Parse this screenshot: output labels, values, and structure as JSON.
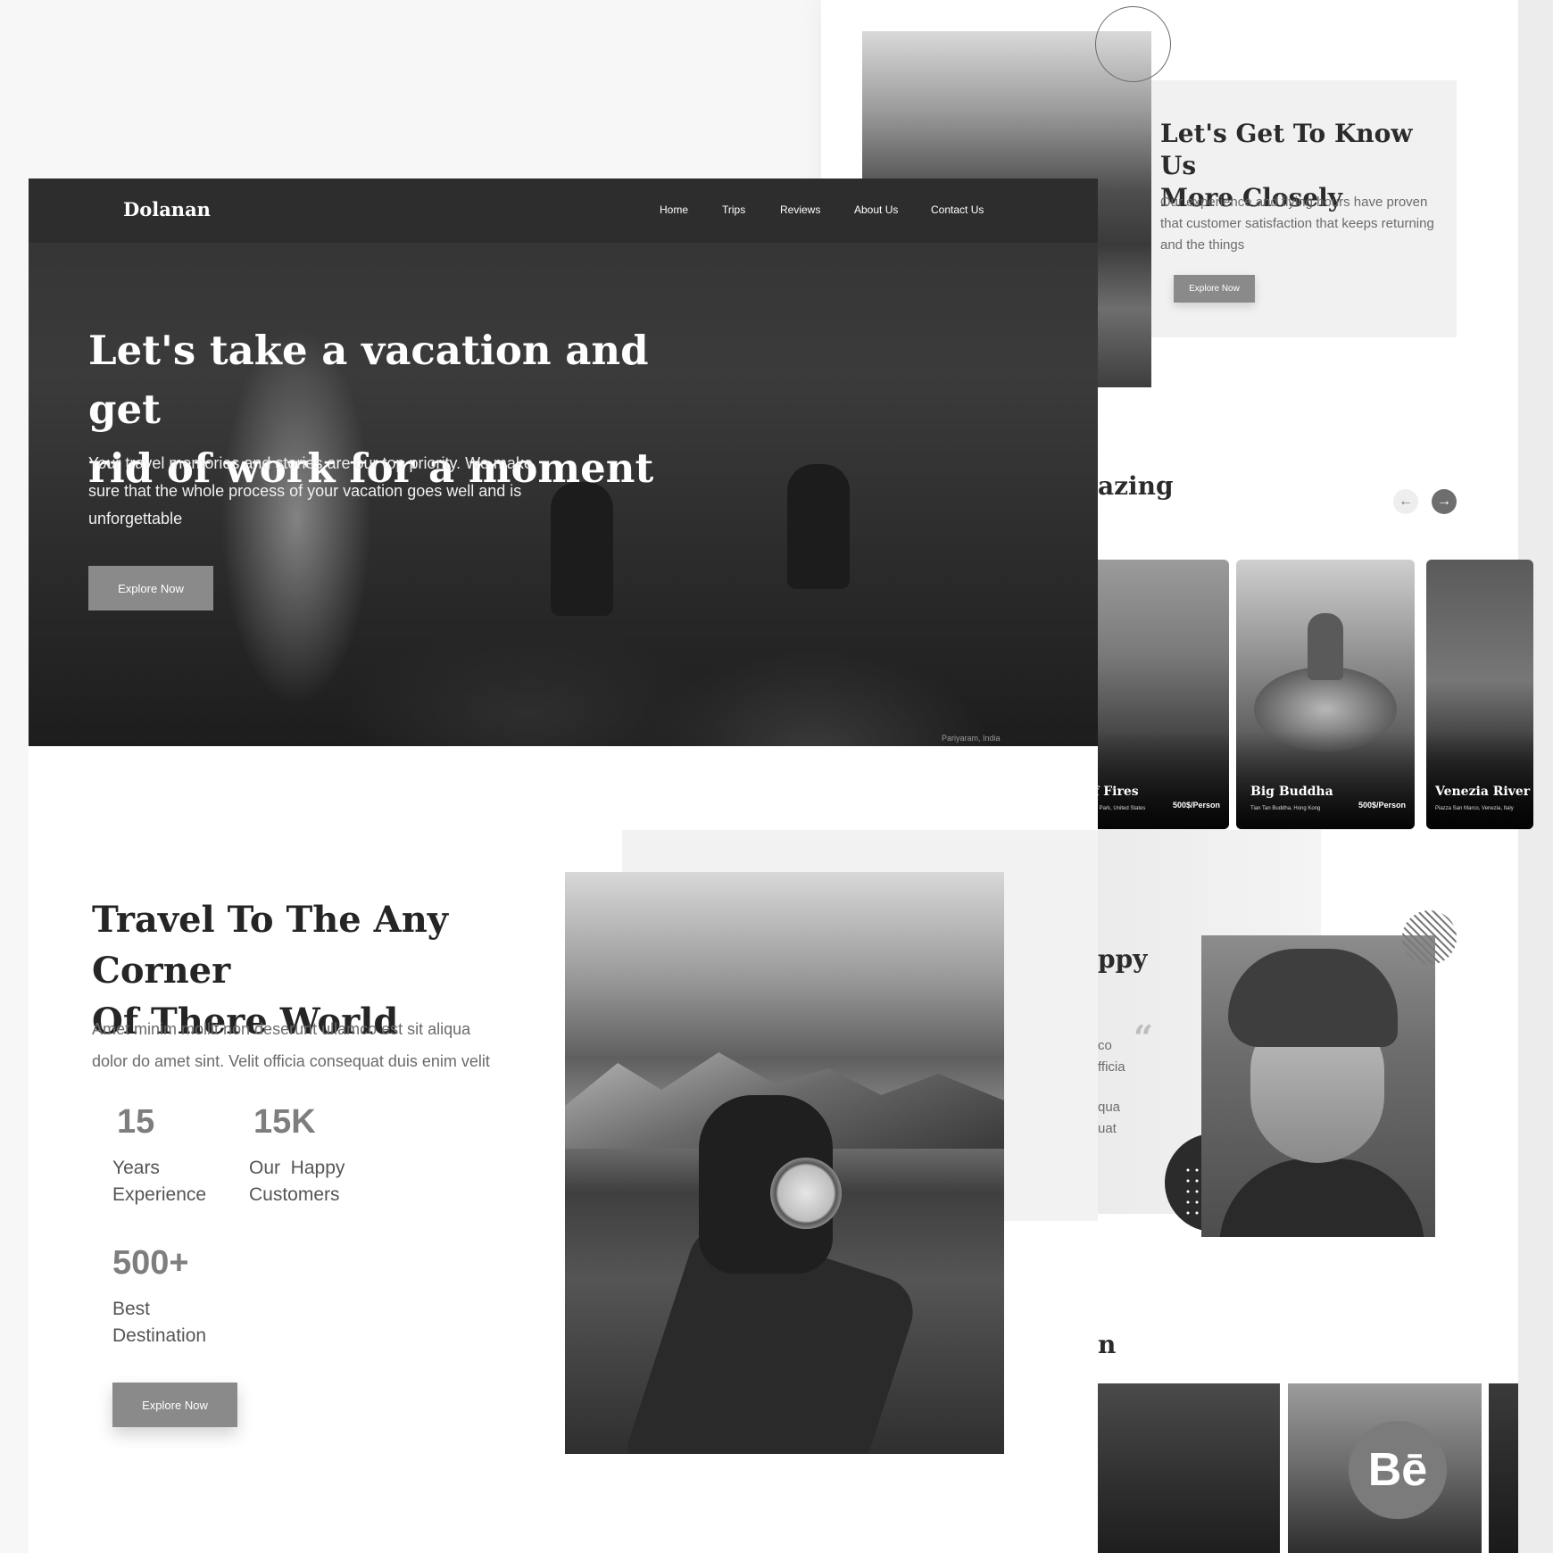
{
  "hero": {
    "logo": "Dolanan",
    "nav": [
      "Home",
      "Trips",
      "Reviews",
      "About Us",
      "Contact Us"
    ],
    "title_line1": "Let's take a vacation and get",
    "title_line2": "rid of work for a moment",
    "subtitle_line1": "Your travel memories and stories are our top priority. We make",
    "subtitle_line2": "sure that the whole process of your vacation goes well and is",
    "subtitle_line3": "unforgettable",
    "button": "Explore Now",
    "photo_caption": "Pariyaram, India"
  },
  "travel": {
    "title_line1": "Travel To The Any Corner",
    "title_line2": "Of There World",
    "text_line1": "Amet minim mollit non deserunt ullamco est sit aliqua",
    "text_line2": "dolor do amet sint. Velit officia consequat duis enim velit",
    "stats": [
      {
        "value": "15",
        "label_line1": "Years",
        "label_line2": "Experience"
      },
      {
        "value": "15K",
        "label_line1": "Our  Happy",
        "label_line2": "Customers"
      },
      {
        "value": "500+",
        "label_line1": "Best",
        "label_line2": "Destination"
      }
    ],
    "button": "Explore Now"
  },
  "about": {
    "title_line1": "Let's Get To Know Us",
    "title_line2": "More Closely",
    "text_line1": "Our experience and flying hours have proven",
    "text_line2": "that customer satisfaction that keeps returning",
    "text_line3": "and the things",
    "button": "Explore Now"
  },
  "destinations": {
    "title_fragment": "azing",
    "cards": [
      {
        "name": "of Fires",
        "location": "State Park, United States",
        "price": "500$/Person"
      },
      {
        "name": "Big Buddha",
        "location": "Tian Tan Buddha, Hong Kong",
        "price": "500$/Person"
      },
      {
        "name": "Venezia River",
        "location": "Piazza San Marco, Venezia, Italy",
        "price": ""
      }
    ]
  },
  "reviews": {
    "title_fragment": "ppy",
    "quote_glyph": "“",
    "lines": [
      "co",
      "fficia",
      "qua",
      "uat"
    ]
  },
  "gallery": {
    "title_fragment": "n",
    "behance_label": "Bē"
  },
  "icons": {
    "prev": "arrow-left-icon",
    "next": "arrow-right-icon",
    "quote": "quote-icon",
    "behance": "behance-logo"
  },
  "colors": {
    "accent_button": "#8a8a8a",
    "nav_bar": "#2c2c2c",
    "text_dark": "#252525",
    "text_muted": "#6b6b6b"
  }
}
